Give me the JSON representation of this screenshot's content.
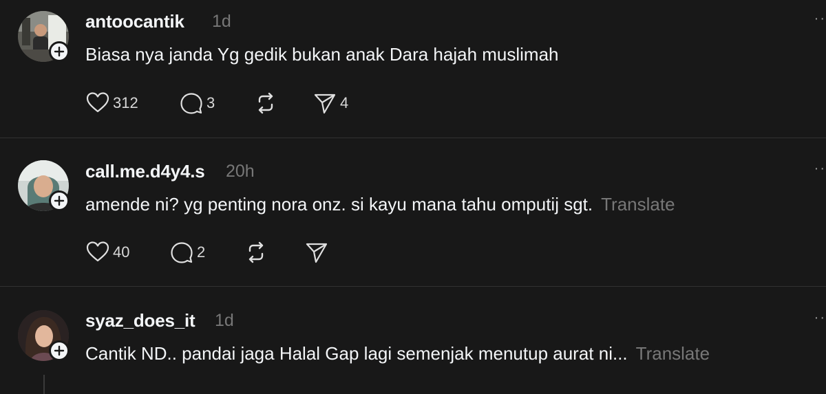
{
  "posts": [
    {
      "username": "antoocantik",
      "time": "1d",
      "text": "Biasa nya janda Yg gedik bukan anak Dara hajah muslimah",
      "translate": "",
      "likes": "312",
      "replies": "3",
      "reposts": "",
      "shares": "4"
    },
    {
      "username": "call.me.d4y4.s",
      "time": "20h",
      "text": "amende ni? yg penting nora onz. si kayu mana tahu omputij sgt.",
      "translate": "Translate",
      "likes": "40",
      "replies": "2",
      "reposts": "",
      "shares": ""
    },
    {
      "username": "syaz_does_it",
      "time": "1d",
      "text": "Cantik ND.. pandai jaga Halal Gap lagi semenjak menutup aurat ni...",
      "translate": "Translate",
      "likes": "",
      "replies": "",
      "reposts": "",
      "shares": ""
    }
  ],
  "icons": {
    "like": "heart-icon",
    "reply": "comment-icon",
    "repost": "repost-icon",
    "share": "send-icon",
    "more": "more-icon",
    "follow": "plus-icon"
  },
  "colors": {
    "background": "#181818",
    "primary_text": "#f3f5f7",
    "secondary_text": "#777777",
    "divider": "#323232"
  }
}
